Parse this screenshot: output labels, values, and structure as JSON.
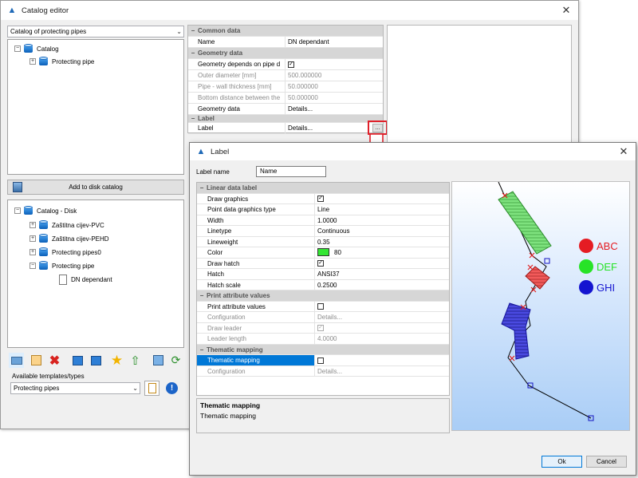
{
  "main_window": {
    "title": "Catalog editor",
    "catalog_selector": "Catalog of protecting pipes",
    "tree_top": [
      {
        "label": "Catalog",
        "indent": 0
      },
      {
        "label": "Protecting pipe",
        "indent": 1
      }
    ],
    "add_to_disk_label": "Add to disk catalog",
    "tree_disk": [
      {
        "label": "Catalog - Disk"
      },
      {
        "label": "Zaštitna cijev-PVC"
      },
      {
        "label": "Zaštitna cijev-PEHD"
      },
      {
        "label": "Protecting pipes0"
      },
      {
        "label": "Protecting pipe"
      },
      {
        "label": "DN dependant"
      }
    ],
    "templates_label": "Available templates/types",
    "templates_value": "Protecting pipes",
    "properties": {
      "common_header": "Common data",
      "name_label": "Name",
      "name_value": "DN dependant",
      "geometry_header": "Geometry data",
      "geometry_depends_label": "Geometry depends on pipe d",
      "outer_diameter_label": "Outer diameter [mm]",
      "outer_diameter_value": "500.000000",
      "wall_thickness_label": "Pipe - wall thickness [mm]",
      "wall_thickness_value": "50.000000",
      "bottom_distance_label": "Bottom distance between the",
      "bottom_distance_value": "50.000000",
      "geometry_data_label": "Geometry data",
      "geometry_data_value": "Details...",
      "label_header": "Label",
      "label_label": "Label",
      "label_value": "Details...",
      "ellipsis": "..."
    }
  },
  "label_dialog": {
    "title": "Label",
    "label_name_caption": "Label name",
    "label_name_value": "Name",
    "linear_header": "Linear data label",
    "rows": {
      "draw_graphics": "Draw graphics",
      "point_type": "Point data graphics type",
      "point_type_value": "Line",
      "width": "Width",
      "width_value": "1.0000",
      "linetype": "Linetype",
      "linetype_value": "Continuous",
      "lineweight": "Lineweight",
      "lineweight_value": "0.35",
      "color": "Color",
      "color_value": "80",
      "color_swatch": "#33e633",
      "draw_hatch": "Draw hatch",
      "hatch": "Hatch",
      "hatch_value": "ANSI37",
      "hatch_scale": "Hatch scale",
      "hatch_scale_value": "0.2500"
    },
    "print_header": "Print attribute values",
    "print_rows": {
      "print_values": "Print attribute values",
      "configuration": "Configuration",
      "configuration_value": "Details...",
      "draw_leader": "Draw leader",
      "leader_length": "Leader length",
      "leader_length_value": "4.0000"
    },
    "thematic_header": "Thematic mapping",
    "thematic_rows": {
      "thematic": "Thematic mapping",
      "configuration": "Configuration",
      "configuration_value": "Details..."
    },
    "description_title": "Thematic mapping",
    "description_text": "Thematic mapping",
    "legend": [
      {
        "label": "ABC",
        "color": "#e51c23"
      },
      {
        "label": "DEF",
        "color": "#27e327"
      },
      {
        "label": "GHI",
        "color": "#1414d0"
      }
    ],
    "ok_label": "Ok",
    "cancel_label": "Cancel"
  }
}
